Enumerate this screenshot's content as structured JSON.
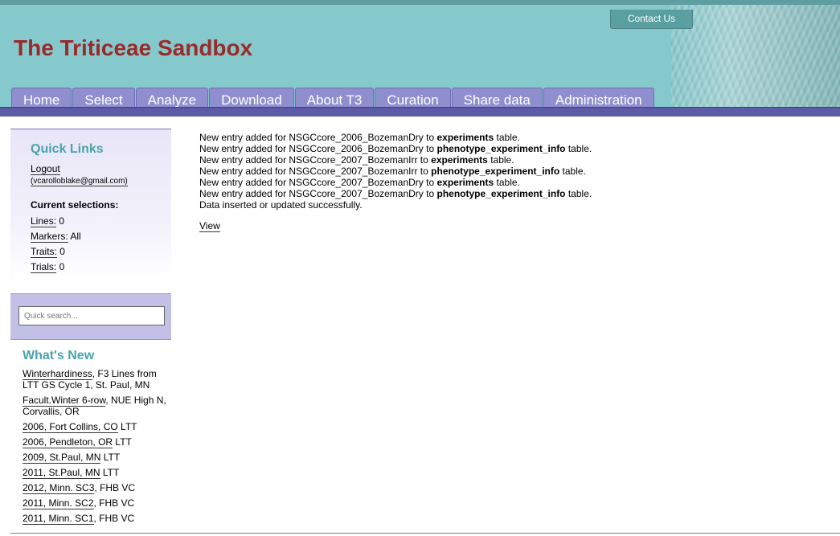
{
  "header": {
    "site_title": "The Triticeae Sandbox",
    "contact_label": "Contact Us",
    "nav": [
      "Home",
      "Select",
      "Analyze",
      "Download",
      "About T3",
      "Curation",
      "Share data",
      "Administration"
    ]
  },
  "colors": {
    "header_bg": "#86c9cc",
    "title": "#9b2a2a",
    "nav_tab": "#8f8fd0",
    "purple_bar": "#5d5aa8",
    "heading_teal": "#4aa3ad"
  },
  "sidebar": {
    "quick_links_title": "Quick Links",
    "logout_label": "Logout",
    "user_email": "(vcarolloblake@gmail.com)",
    "current_selections_title": "Current selections:",
    "selections": [
      {
        "label": "Lines:",
        "value": "0"
      },
      {
        "label": "Markers:",
        "value": "All"
      },
      {
        "label": "Traits:",
        "value": "0"
      },
      {
        "label": "Trials:",
        "value": "0"
      }
    ],
    "search_placeholder": "Quick search...",
    "whats_new_title": "What's New",
    "whats_new": [
      {
        "link": "Winterhardiness",
        "rest": ", F3 Lines from LTT GS Cycle 1, St. Paul, MN"
      },
      {
        "link": "Facult.Winter 6-row",
        "rest": ", NUE High N, Corvallis, OR"
      },
      {
        "link": "2006, Fort Collins, CO",
        "rest": " LTT"
      },
      {
        "link": "2006, Pendleton, OR",
        "rest": " LTT"
      },
      {
        "link": "2009, St.Paul, MN",
        "rest": " LTT"
      },
      {
        "link": "2011, St.Paul, MN",
        "rest": " LTT"
      },
      {
        "link": "2012, Minn. SC3",
        "rest": ", FHB VC"
      },
      {
        "link": "2011, Minn. SC2",
        "rest": ", FHB VC"
      },
      {
        "link": "2011, Minn. SC1",
        "rest": ", FHB VC"
      }
    ]
  },
  "main": {
    "messages": [
      {
        "prefix": "New entry added for NSGCcore_2006_BozemanDry to ",
        "table": "experiments",
        "suffix": " table."
      },
      {
        "prefix": "New entry added for NSGCcore_2006_BozemanDry to ",
        "table": "phenotype_experiment_info",
        "suffix": " table."
      },
      {
        "prefix": "New entry added for NSGCcore_2007_BozemanIrr to ",
        "table": "experiments",
        "suffix": " table."
      },
      {
        "prefix": "New entry added for NSGCcore_2007_BozemanIrr to ",
        "table": "phenotype_experiment_info",
        "suffix": " table."
      },
      {
        "prefix": "New entry added for NSGCcore_2007_BozemanDry to ",
        "table": "experiments",
        "suffix": " table."
      },
      {
        "prefix": "New entry added for NSGCcore_2007_BozemanDry to ",
        "table": "phenotype_experiment_info",
        "suffix": " table."
      }
    ],
    "success_message": "Data inserted or updated successfully.",
    "view_label": "View"
  }
}
